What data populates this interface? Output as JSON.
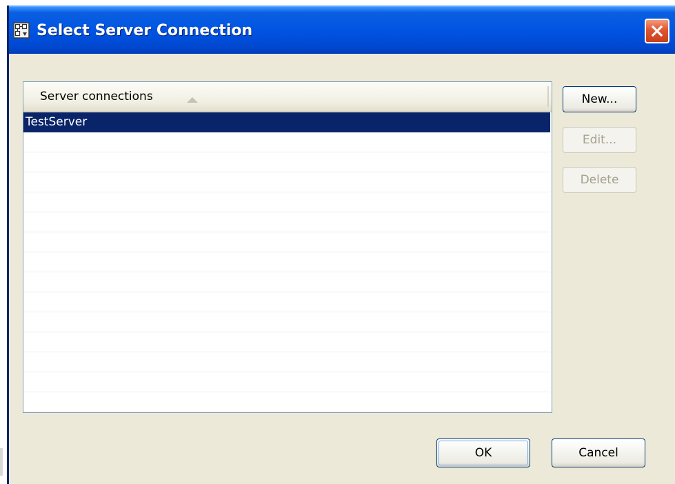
{
  "window": {
    "title": "Select Server Connection",
    "icon": "server-connection-icon",
    "close_icon": "close-icon"
  },
  "list": {
    "column_header": "Server connections",
    "sort_icon": "sort-ascending-icon",
    "rows": [
      "TestServer"
    ],
    "selected_row": 0
  },
  "buttons": {
    "new_label": "New...",
    "edit_label": "Edit...",
    "delete_label": "Delete",
    "ok_label": "OK",
    "cancel_label": "Cancel"
  },
  "colors": {
    "selection": "#0A246A",
    "titlebar": "#0054E3",
    "dialog_background": "#ECE9D8",
    "close_button": "#E0552F"
  }
}
